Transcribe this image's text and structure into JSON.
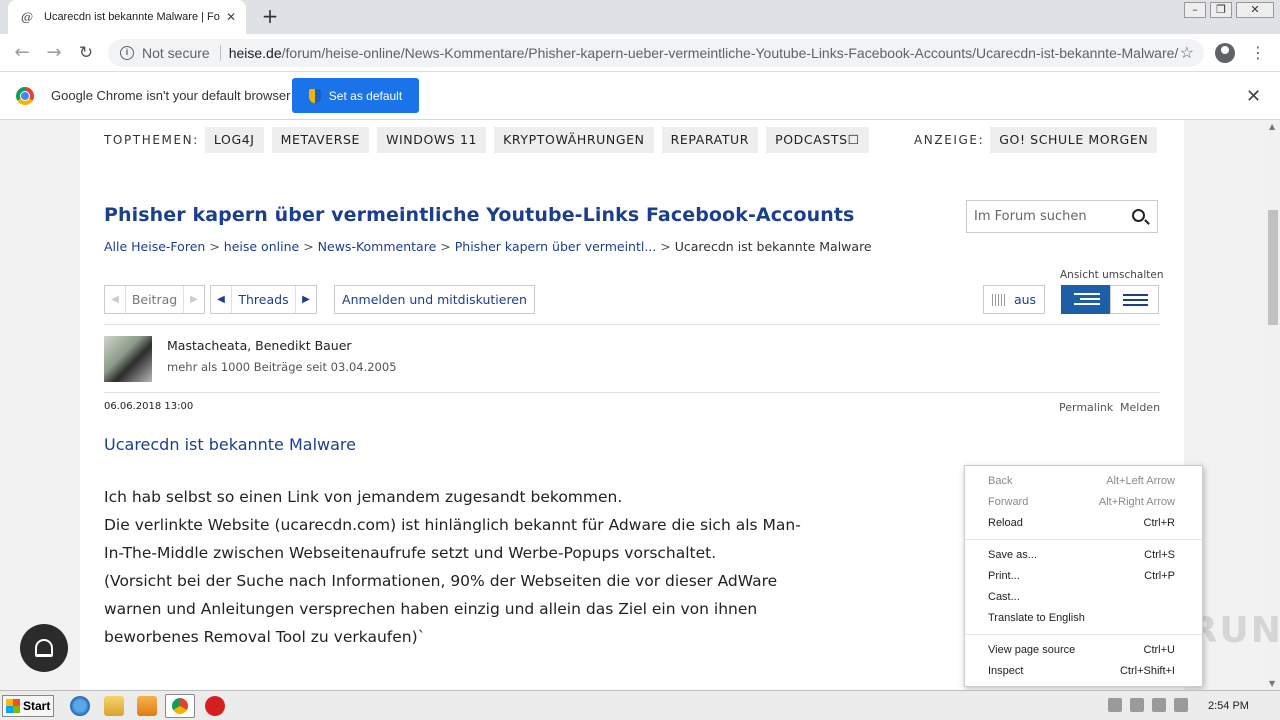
{
  "browser": {
    "tab_title": "Ucarecdn ist bekannte Malware | Fo",
    "tab_favicon": "@",
    "new_tab": "+",
    "security_label": "Not secure",
    "url_domain": "heise.de",
    "url_path": "/forum/heise-online/News-Kommentare/Phisher-kapern-ueber-vermeintliche-Youtube-Links-Facebook-Accounts/Ucarecdn-ist-bekannte-Malware/...",
    "infobar_text": "Google Chrome isn't your default browser",
    "set_default_label": "Set as default"
  },
  "page": {
    "topthemen_label": "TOPTHEMEN:",
    "topics": [
      "LOG4J",
      "METAVERSE",
      "WINDOWS 11",
      "KRYPTOWÄHRUNGEN",
      "REPARATUR",
      "PODCASTS☐"
    ],
    "anzeige_label": "ANZEIGE:",
    "anzeige_topic": "GO! SCHULE MORGEN",
    "thread_title": "Phisher kapern über vermeintliche Youtube-Links Facebook-Accounts",
    "search_placeholder": "Im Forum suchen",
    "breadcrumb": [
      "Alle Heise-Foren",
      "heise online",
      "News-Kommentare",
      "Phisher kapern über vermeintl...",
      "Ucarecdn ist bekannte Malware"
    ],
    "breadcrumb_sep": ">",
    "beitrag_label": "Beitrag",
    "threads_label": "Threads",
    "login_label": "Anmelden und mitdiskutieren",
    "ansicht_label": "Ansicht umschalten",
    "aus_label": "aus",
    "author_name": "Mastacheata, Benedikt Bauer",
    "author_meta": "mehr als 1000 Beiträge seit 03.04.2005",
    "post_date": "06.06.2018 13:00",
    "permalink_label": "Permalink",
    "melden_label": "Melden",
    "post_title": "Ucarecdn ist bekannte Malware",
    "post_body": [
      "Ich hab selbst so einen Link von jemandem zugesandt bekommen.",
      "Die verlinkte Website (ucarecdn.com) ist hinlänglich bekannt für Adware die sich als Man-",
      "In-The-Middle zwischen Webseitenaufrufe setzt und Werbe-Popups vorschaltet.",
      "(Vorsicht bei der Suche nach Informationen, 90% der Webseiten die vor dieser AdWare",
      "warnen und Anleitungen versprechen haben einzig und allein das Ziel ein von ihnen",
      "beworbenes Removal Tool zu verkaufen)`"
    ]
  },
  "context_menu": {
    "items": [
      {
        "label": "Back",
        "shortcut": "Alt+Left Arrow"
      },
      {
        "label": "Forward",
        "shortcut": "Alt+Right Arrow"
      },
      {
        "label": "Reload",
        "shortcut": "Ctrl+R"
      },
      {
        "label": "Save as...",
        "shortcut": "Ctrl+S"
      },
      {
        "label": "Print...",
        "shortcut": "Ctrl+P"
      },
      {
        "label": "Cast...",
        "shortcut": ""
      },
      {
        "label": "Translate to English",
        "shortcut": ""
      },
      {
        "label": "View page source",
        "shortcut": "Ctrl+U"
      },
      {
        "label": "Inspect",
        "shortcut": "Ctrl+Shift+I"
      }
    ]
  },
  "watermark": "ANY.RUN",
  "taskbar": {
    "start_label": "Start",
    "clock": "2:54 PM"
  },
  "colors": {
    "heise_blue": "#1c3f8c",
    "chrome_blue": "#1a73e8",
    "view_active": "#1c5fa8"
  }
}
